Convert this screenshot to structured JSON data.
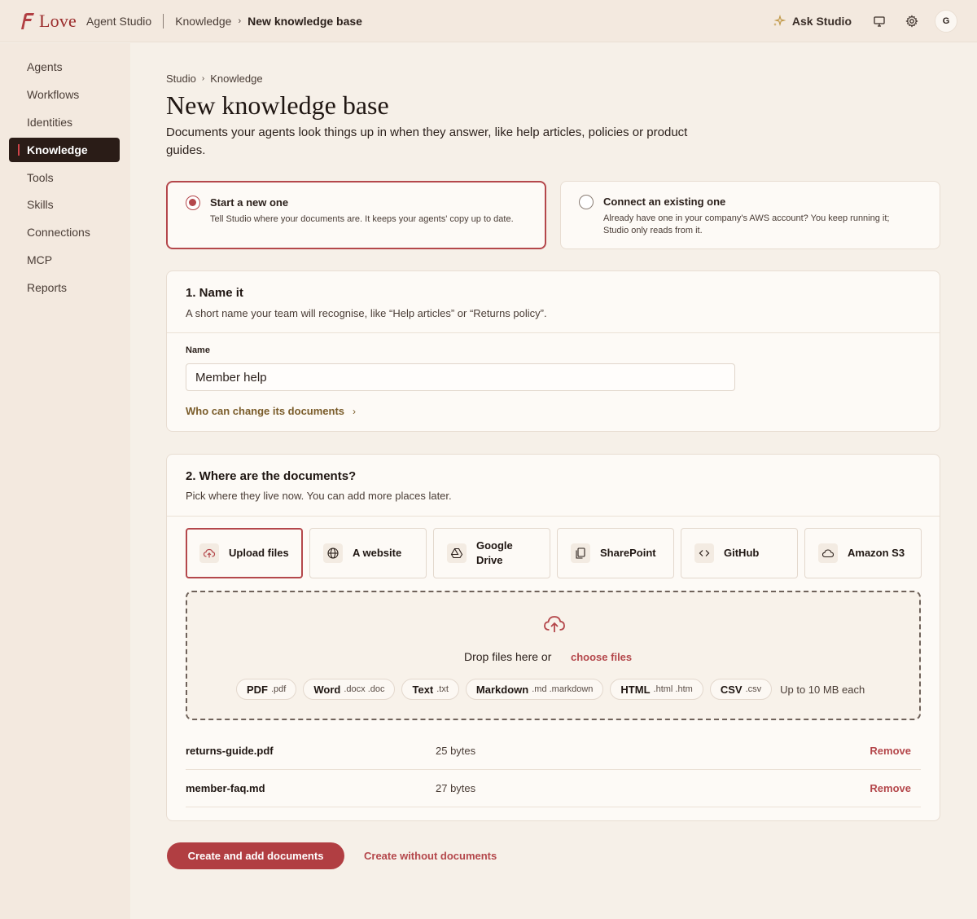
{
  "topbar": {
    "brand_name": "Love",
    "brand_sub": "Agent Studio",
    "crumb_parent": "Knowledge",
    "crumb_current": "New knowledge base",
    "ask_label": "Ask Studio",
    "avatar_initial": "G"
  },
  "sidebar": {
    "items": [
      {
        "label": "Agents"
      },
      {
        "label": "Workflows"
      },
      {
        "label": "Identities"
      },
      {
        "label": "Knowledge",
        "active": true
      },
      {
        "label": "Tools"
      },
      {
        "label": "Skills"
      },
      {
        "label": "Connections"
      },
      {
        "label": "MCP"
      },
      {
        "label": "Reports"
      }
    ]
  },
  "page": {
    "breadcrumb": [
      "Studio",
      "Knowledge"
    ],
    "title": "New knowledge base",
    "description": "Documents your agents look things up in when they answer, like help articles, policies or product guides."
  },
  "modes": [
    {
      "title": "Start a new one",
      "desc": "Tell Studio where your documents are. It keeps your agents' copy up to date.",
      "selected": true
    },
    {
      "title": "Connect an existing one",
      "desc": "Already have one in your company's AWS account? You keep running it; Studio only reads from it.",
      "selected": false
    }
  ],
  "name_section": {
    "title": "1. Name it",
    "subtitle": "A short name your team will recognise, like “Help articles” or “Returns policy”.",
    "field_label": "Name",
    "field_value": "Member help",
    "access_link": "Who can change its documents"
  },
  "docs_section": {
    "title": "2. Where are the documents?",
    "subtitle": "Pick where they live now. You can add more places later.",
    "sources": [
      {
        "label": "Upload files",
        "icon": "upload-cloud-icon",
        "selected": true
      },
      {
        "label": "A website",
        "icon": "globe-icon"
      },
      {
        "label": "Google Drive",
        "icon": "drive-icon"
      },
      {
        "label": "SharePoint",
        "icon": "document-copy-icon"
      },
      {
        "label": "GitHub",
        "icon": "code-icon"
      },
      {
        "label": "Amazon S3",
        "icon": "cloud-icon"
      }
    ],
    "drop_text": "Drop files here or",
    "choose_link": "choose files",
    "file_types": [
      {
        "name": "PDF",
        "ext": ".pdf"
      },
      {
        "name": "Word",
        "ext": ".docx .doc"
      },
      {
        "name": "Text",
        "ext": ".txt"
      },
      {
        "name": "Markdown",
        "ext": ".md .markdown"
      },
      {
        "name": "HTML",
        "ext": ".html .htm"
      },
      {
        "name": "CSV",
        "ext": ".csv"
      }
    ],
    "size_limit": "Up to 10 MB each",
    "files": [
      {
        "name": "returns-guide.pdf",
        "size": "25 bytes",
        "action": "Remove"
      },
      {
        "name": "member-faq.md",
        "size": "27 bytes",
        "action": "Remove"
      }
    ]
  },
  "actions": {
    "primary": "Create and add documents",
    "secondary": "Create without documents"
  },
  "colors": {
    "accent": "#b4474b",
    "primary_button": "#b13e42",
    "background": "#f6f0e8",
    "sidebar_active": "#2a1c17"
  }
}
